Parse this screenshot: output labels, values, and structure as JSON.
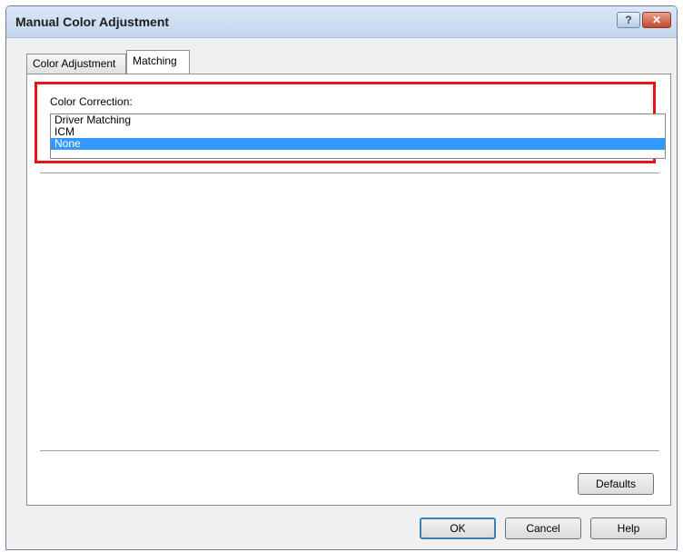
{
  "window": {
    "title": "Manual Color Adjustment",
    "help_button": "?",
    "close_button": "✕"
  },
  "tabs": [
    {
      "label": "Color Adjustment",
      "selected": false
    },
    {
      "label": "Matching",
      "selected": true
    }
  ],
  "color_correction": {
    "label": "Color Correction:",
    "options": [
      "Driver Matching",
      "ICM",
      "None"
    ],
    "selected": "None"
  },
  "buttons": {
    "defaults": "Defaults",
    "ok": "OK",
    "cancel": "Cancel",
    "help": "Help"
  },
  "colors": {
    "highlight_border": "#e8121b",
    "selection": "#3399ff"
  }
}
